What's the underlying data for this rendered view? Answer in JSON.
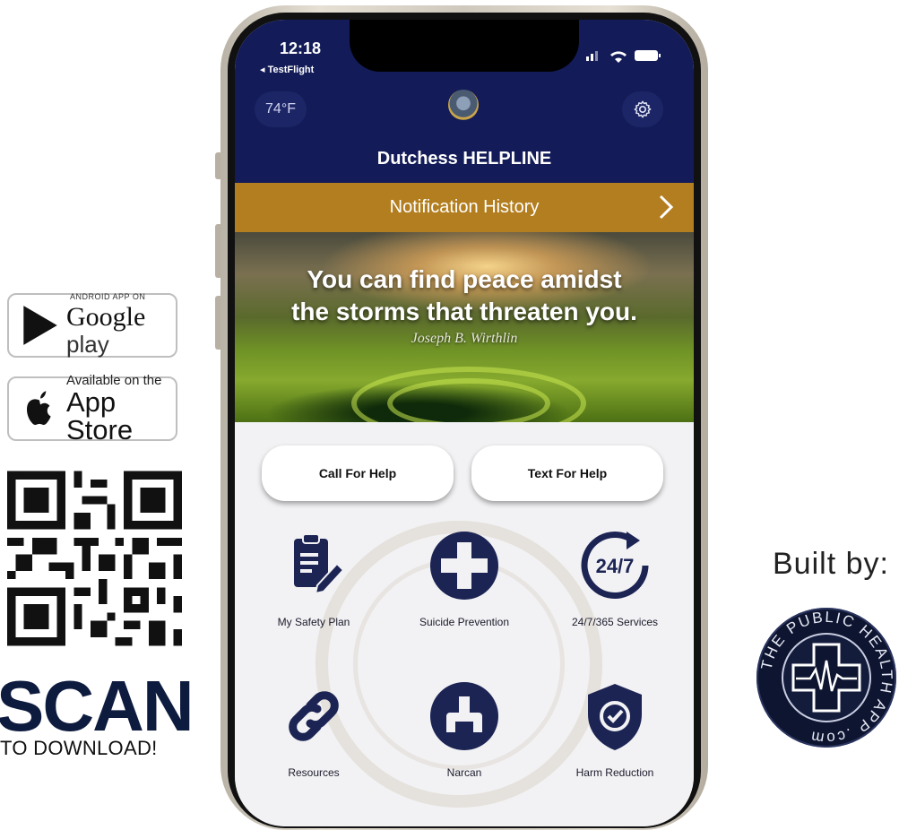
{
  "left_panel": {
    "google_play": {
      "small": "ANDROID APP ON",
      "brand": "Google",
      "word": "play"
    },
    "app_store": {
      "small": "Available on the",
      "big": "App Store"
    },
    "scan": "SCAN",
    "to_download": "TO DOWNLOAD!"
  },
  "right_panel": {
    "built_by": "Built by:",
    "logo_text": "THE PUBLIC HEALTH APP .com"
  },
  "phone": {
    "status_bar": {
      "time": "12:18",
      "back_app": "◂ TestFlight"
    },
    "header": {
      "temperature": "74°F",
      "title": "Dutchess HELPLINE"
    },
    "notification_bar": {
      "label": "Notification History"
    },
    "hero": {
      "quote_line1": "You can find peace amidst",
      "quote_line2": "the storms that threaten you.",
      "author": "Joseph B. Wirthlin"
    },
    "buttons": {
      "call": "Call For Help",
      "text": "Text For Help"
    },
    "tiles": [
      {
        "label": "My Safety Plan",
        "icon": "safety-plan-icon"
      },
      {
        "label": "Suicide Prevention",
        "icon": "cross-icon"
      },
      {
        "label": "24/7/365 Services",
        "icon": "clock-24-7-icon",
        "icon_text": "24/7"
      },
      {
        "label": "Resources",
        "icon": "link-icon"
      },
      {
        "label": "Narcan",
        "icon": "nasal-spray-icon"
      },
      {
        "label": "Harm Reduction",
        "icon": "shield-check-icon"
      }
    ]
  },
  "colors": {
    "navy": "#131c58",
    "gold": "#b37e1f",
    "icon_navy": "#1c2454",
    "scan_navy": "#0d1b3e"
  }
}
